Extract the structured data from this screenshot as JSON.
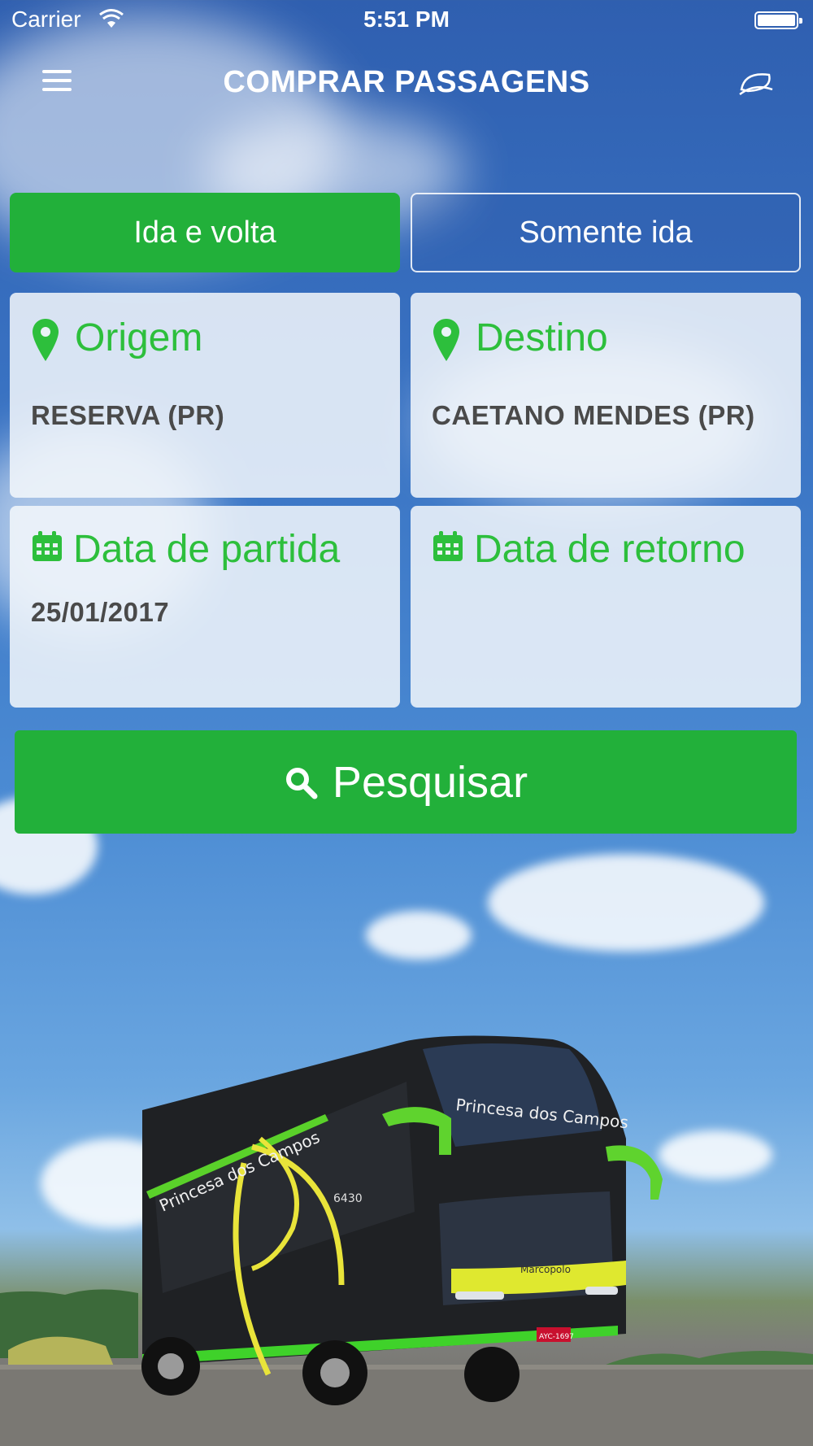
{
  "status_bar": {
    "carrier": "Carrier",
    "time": "5:51 PM"
  },
  "header": {
    "title": "COMPRAR PASSAGENS",
    "menu_icon": "hamburger-menu-icon",
    "right_icon": "leaf-icon"
  },
  "trip_type": {
    "round_trip": "Ida e volta",
    "one_way": "Somente ida",
    "selected": "round_trip"
  },
  "origin": {
    "label": "Origem",
    "value": "RESERVA (PR)",
    "icon": "location-pin-icon"
  },
  "destination": {
    "label": "Destino",
    "value": "CAETANO MENDES (PR)",
    "icon": "location-pin-icon"
  },
  "departure": {
    "label": "Data de partida",
    "value": "25/01/2017",
    "icon": "calendar-icon"
  },
  "return": {
    "label": "Data de retorno",
    "value": "",
    "icon": "calendar-icon"
  },
  "search_button": {
    "label": "Pesquisar",
    "icon": "search-icon"
  },
  "bus": {
    "brand_text": "Princesa dos Campos",
    "model_text": "Marcopolo",
    "fleet_number": "6430",
    "plate": "AYC-1697"
  },
  "colors": {
    "accent_green": "#22b03a",
    "label_green": "#2dbf3c",
    "sky": "#3a74c4"
  }
}
